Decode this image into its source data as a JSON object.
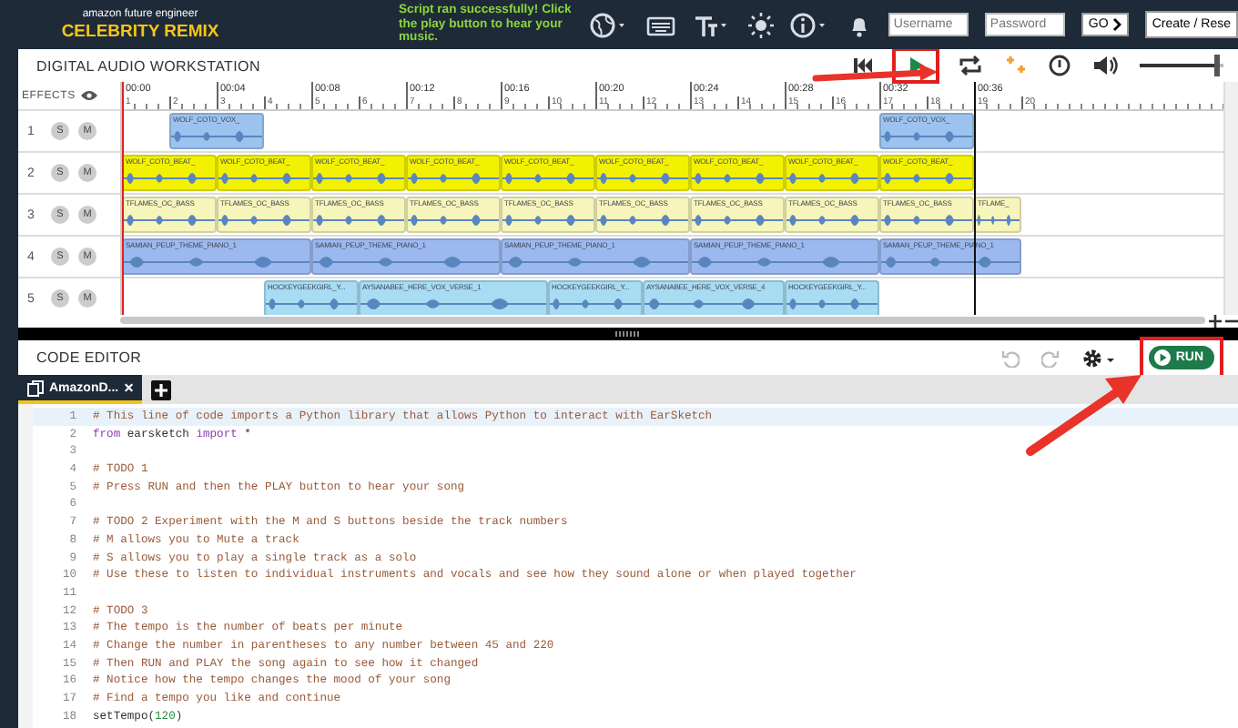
{
  "header": {
    "logo_caption": "amazon future engineer",
    "logo_title": "CELEBRITY REMIX",
    "message": "Script ran successfully! Click the play button to hear your music.",
    "username": {
      "placeholder": "Username"
    },
    "password": {
      "placeholder": "Password"
    },
    "go_button": "GO",
    "create_button": "Create / Rese"
  },
  "daw": {
    "title": "DIGITAL AUDIO WORKSTATION",
    "play_highlighted": true,
    "volume": {
      "level": 0.95
    },
    "effects_label": "EFFECTS",
    "ruler": {
      "times": [
        "00:00",
        "00:04",
        "00:08",
        "00:12",
        "00:16",
        "00:20",
        "00:24",
        "00:28",
        "00:32",
        "00:36"
      ],
      "measures": [
        "1",
        "2",
        "3",
        "4",
        "5",
        "6",
        "7",
        "8",
        "9",
        "10",
        "11",
        "12",
        "13",
        "14",
        "15",
        "16",
        "17",
        "18",
        "19",
        "20"
      ]
    },
    "tracks": [
      {
        "number": "1",
        "solo": "S",
        "mute": "M",
        "clips": [
          {
            "name": "WOLF_COTO_VOX_",
            "color": "#9cc3ef"
          },
          {
            "name": "WOLF_COTO_VOX_",
            "color": "#9cc3ef"
          }
        ]
      },
      {
        "number": "2",
        "solo": "S",
        "mute": "M",
        "clips": [
          {
            "name": "WOLF_COTO_BEAT_",
            "color": "#f2f200"
          },
          {
            "name": "WOLF_COTO_BEAT_",
            "color": "#f2f200"
          },
          {
            "name": "WOLF_COTO_BEAT_",
            "color": "#f2f200"
          },
          {
            "name": "WOLF_COTO_BEAT_",
            "color": "#f2f200"
          },
          {
            "name": "WOLF_COTO_BEAT_",
            "color": "#f2f200"
          },
          {
            "name": "WOLF_COTO_BEAT_",
            "color": "#f2f200"
          },
          {
            "name": "WOLF_COTO_BEAT_",
            "color": "#f2f200"
          },
          {
            "name": "WOLF_COTO_BEAT_",
            "color": "#f2f200"
          },
          {
            "name": "WOLF_COTO_BEAT_",
            "color": "#f2f200"
          }
        ]
      },
      {
        "number": "3",
        "solo": "S",
        "mute": "M",
        "clips": [
          {
            "name": "TFLAMES_OC_BASS",
            "color": "#f5f5bc"
          },
          {
            "name": "TFLAMES_OC_BASS",
            "color": "#f5f5bc"
          },
          {
            "name": "TFLAMES_OC_BASS",
            "color": "#f5f5bc"
          },
          {
            "name": "TFLAMES_OC_BASS",
            "color": "#f5f5bc"
          },
          {
            "name": "TFLAMES_OC_BASS",
            "color": "#f5f5bc"
          },
          {
            "name": "TFLAMES_OC_BASS",
            "color": "#f5f5bc"
          },
          {
            "name": "TFLAMES_OC_BASS",
            "color": "#f5f5bc"
          },
          {
            "name": "TFLAMES_OC_BASS",
            "color": "#f5f5bc"
          },
          {
            "name": "TFLAMES_OC_BASS",
            "color": "#f5f5bc"
          },
          {
            "name": "TFLAME_",
            "color": "#f5f5bc"
          }
        ]
      },
      {
        "number": "4",
        "solo": "S",
        "mute": "M",
        "clips": [
          {
            "name": "SAMIAN_PEUP_THEME_PIANO_1",
            "color": "#9cb9ef"
          },
          {
            "name": "SAMIAN_PEUP_THEME_PIANO_1",
            "color": "#9cb9ef"
          },
          {
            "name": "SAMIAN_PEUP_THEME_PIANO_1",
            "color": "#9cb9ef"
          },
          {
            "name": "SAMIAN_PEUP_THEME_PIANO_1",
            "color": "#9cb9ef"
          },
          {
            "name": "SAMIAN_PEUP_THEME_PIANO_1",
            "color": "#9cb9ef"
          }
        ]
      },
      {
        "number": "5",
        "solo": "S",
        "mute": "M",
        "clips": [
          {
            "name": "HOCKEYGEEKGIRL_Y...",
            "color": "#a7dcf2"
          },
          {
            "name": "AYSANABEE_HERE_VOX_VERSE_1",
            "color": "#a7dcf2"
          },
          {
            "name": "HOCKEYGEEKGIRL_Y...",
            "color": "#a7dcf2"
          },
          {
            "name": "AYSANABEE_HERE_VOX_VERSE_4",
            "color": "#a7dcf2"
          },
          {
            "name": "HOCKEYGEEKGIRL_Y...",
            "color": "#a7dcf2"
          }
        ]
      }
    ]
  },
  "code_editor": {
    "title": "CODE EDITOR",
    "run_button": "RUN",
    "run_highlighted": true,
    "tabs": [
      {
        "label": "AmazonD...",
        "close": "×",
        "selected": true
      }
    ],
    "lines": [
      {
        "number": "1",
        "active": true,
        "tokens": [
          {
            "kind": "comment",
            "text": "# This line of code imports a Python library that allows Python to interact with EarSketch"
          }
        ]
      },
      {
        "number": "2",
        "active": false,
        "tokens": [
          {
            "kind": "keyword",
            "text": "from"
          },
          {
            "kind": "plain",
            "text": " earsketch "
          },
          {
            "kind": "keyword",
            "text": "import"
          },
          {
            "kind": "plain",
            "text": " *"
          }
        ]
      },
      {
        "number": "3",
        "active": false
      },
      {
        "number": "4",
        "active": false,
        "tokens": [
          {
            "kind": "comment",
            "text": "# TODO 1"
          }
        ]
      },
      {
        "number": "5",
        "active": false,
        "tokens": [
          {
            "kind": "comment",
            "text": "# Press RUN and then the PLAY button to hear your song"
          }
        ]
      },
      {
        "number": "6",
        "active": false
      },
      {
        "number": "7",
        "active": false,
        "tokens": [
          {
            "kind": "comment",
            "text": "# TODO 2 Experiment with the M and S buttons beside the track numbers"
          }
        ]
      },
      {
        "number": "8",
        "active": false,
        "tokens": [
          {
            "kind": "comment",
            "text": "# M allows you to Mute a track"
          }
        ]
      },
      {
        "number": "9",
        "active": false,
        "tokens": [
          {
            "kind": "comment",
            "text": "# S allows you to play a single track as a solo"
          }
        ]
      },
      {
        "number": "10",
        "active": false,
        "tokens": [
          {
            "kind": "comment",
            "text": "# Use these to listen to individual instruments and vocals and see how they sound alone or when played together"
          }
        ]
      },
      {
        "number": "11",
        "active": false
      },
      {
        "number": "12",
        "active": false,
        "tokens": [
          {
            "kind": "comment",
            "text": "# TODO 3"
          }
        ]
      },
      {
        "number": "13",
        "active": false,
        "tokens": [
          {
            "kind": "comment",
            "text": "# The tempo is the number of beats per minute"
          }
        ]
      },
      {
        "number": "14",
        "active": false,
        "tokens": [
          {
            "kind": "comment",
            "text": "# Change the number in parentheses to any number between 45 and 220"
          }
        ]
      },
      {
        "number": "15",
        "active": false,
        "tokens": [
          {
            "kind": "comment",
            "text": "# Then RUN and PLAY the song again to see how it changed"
          }
        ]
      },
      {
        "number": "16",
        "active": false,
        "tokens": [
          {
            "kind": "comment",
            "text": "# Notice how the tempo changes the mood of your song"
          }
        ]
      },
      {
        "number": "17",
        "active": false,
        "tokens": [
          {
            "kind": "comment",
            "text": "# Find a tempo you like and continue"
          }
        ]
      },
      {
        "number": "18",
        "active": false,
        "tokens": [
          {
            "kind": "plain",
            "text": "setTempo("
          },
          {
            "kind": "number",
            "text": "120"
          },
          {
            "kind": "plain",
            "text": ")"
          }
        ]
      }
    ]
  }
}
